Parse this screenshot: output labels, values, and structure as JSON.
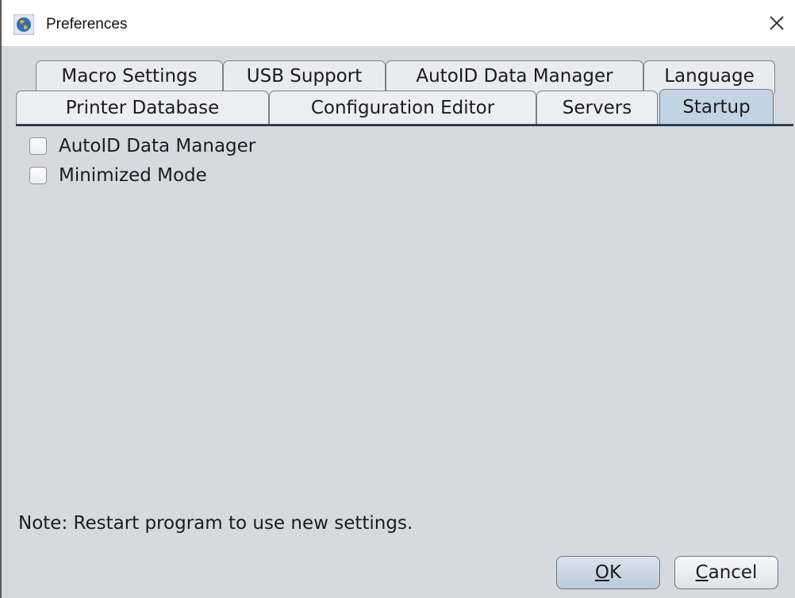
{
  "window": {
    "title": "Preferences",
    "app_icon": "globe-icon",
    "close_icon": "close-icon"
  },
  "tabs": {
    "row1": [
      {
        "label": "Macro Settings"
      },
      {
        "label": "USB Support"
      },
      {
        "label": "AutoID Data Manager"
      },
      {
        "label": "Language"
      }
    ],
    "row2": [
      {
        "label": "Printer Database"
      },
      {
        "label": "Configuration Editor"
      },
      {
        "label": "Servers"
      },
      {
        "label": "Startup",
        "selected": true
      }
    ]
  },
  "startup": {
    "options": [
      {
        "label": "AutoID Data Manager",
        "checked": false
      },
      {
        "label": "Minimized Mode",
        "checked": false
      }
    ],
    "note": "Note: Restart program to use new settings."
  },
  "buttons": {
    "ok": {
      "mnemonic": "O",
      "rest": "K"
    },
    "cancel": {
      "mnemonic": "C",
      "rest": "ancel"
    }
  },
  "colors": {
    "background": "#d6d9df",
    "selected_tab": "#c2d3e4",
    "tab_separator": "#2e3f52"
  }
}
